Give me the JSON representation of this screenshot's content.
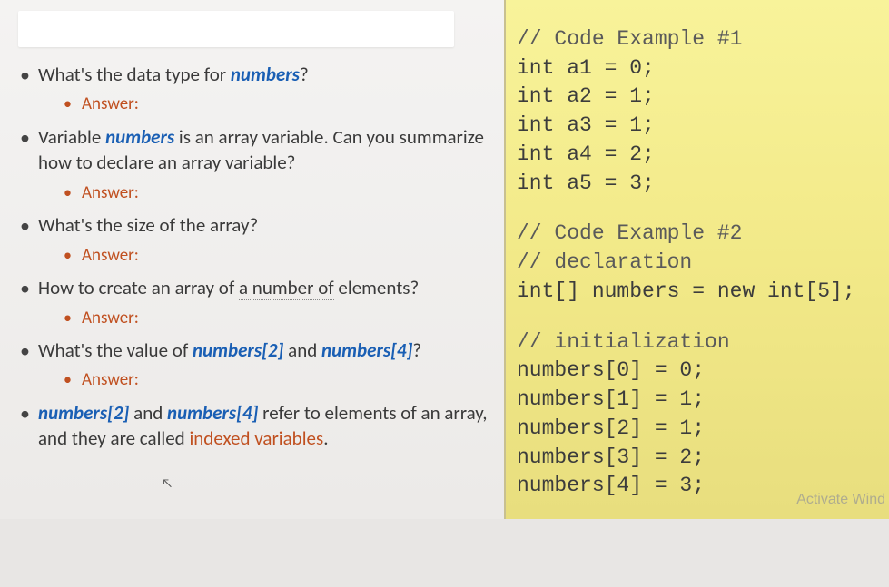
{
  "questions": {
    "q1_prefix": "What's the data type for ",
    "q1_var": "numbers",
    "q1_suffix": "?",
    "answer_label": "Answer:",
    "q2_prefix": "Variable ",
    "q2_var": "numbers",
    "q2_mid": " is an array variable. Can you summarize how to declare an array variable?",
    "q3": "What's the size of the array?",
    "q4_prefix": "How to create an array of ",
    "q4_dotted": "a number of",
    "q4_suffix": " elements?",
    "q5_prefix": "What's the value of ",
    "q5_v1": "numbers[2]",
    "q5_mid": " and ",
    "q5_v2": "numbers[4]",
    "q5_suffix": "?",
    "q6_v1": "numbers[2]",
    "q6_mid1": " and ",
    "q6_v2": "numbers[4]",
    "q6_mid2": " refer to elements of an array, and they are called ",
    "q6_term": "indexed variables",
    "q6_end": "."
  },
  "code": {
    "c1_comment": "// Code Example #1",
    "c1_l1": "int a1 = 0;",
    "c1_l2": "int a2 = 1;",
    "c1_l3": "int a3 = 1;",
    "c1_l4": "int a4 = 2;",
    "c1_l5": "int a5 = 3;",
    "c2_comment": "// Code Example #2",
    "c2_decl_comment": "// declaration",
    "c2_decl": "int[] numbers = new int[5];",
    "c2_init_comment": "// initialization",
    "c2_i0": "numbers[0] = 0;",
    "c2_i1": "numbers[1] = 1;",
    "c2_i2": "numbers[2] = 1;",
    "c2_i3": "numbers[3] = 2;",
    "c2_i4": "numbers[4] = 3;"
  },
  "watermark": "Activate Wind"
}
